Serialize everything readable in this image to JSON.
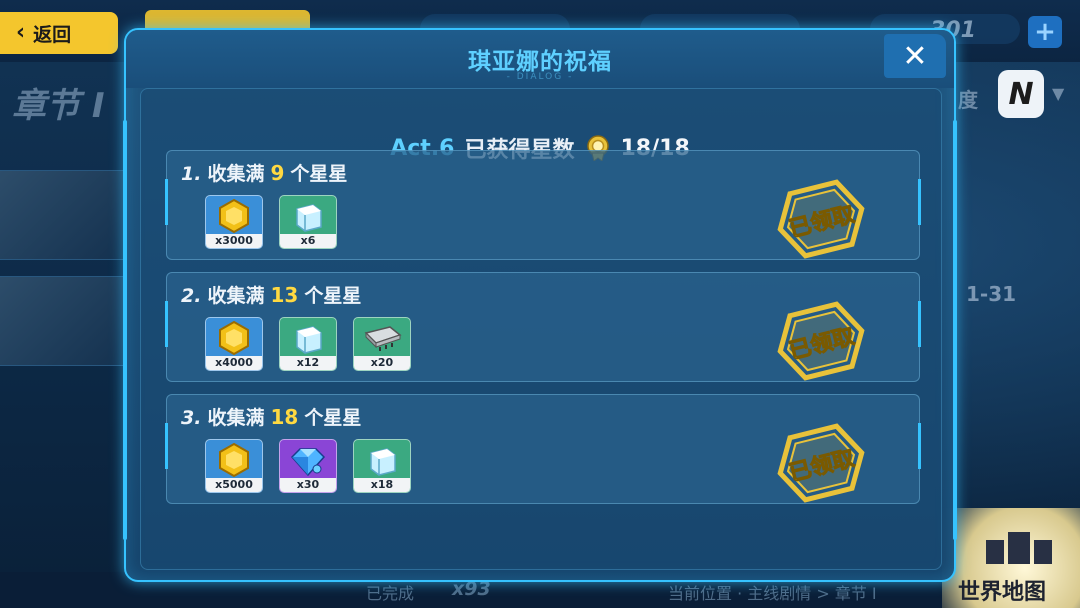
{
  "background": {
    "back_label": "返回",
    "chapter": "章节 I",
    "difficulty_label": "度",
    "difficulty_value": "N",
    "stage_code": "1-31",
    "top_count": "301",
    "footer": {
      "complete_label": "已完成",
      "complete_count": "x93",
      "location": "当前位置 · 主线剧情 > 章节 I"
    },
    "world_map_label": "世界地图"
  },
  "dialog": {
    "title": "琪亚娜的祝福",
    "subtitle": "DIALOG",
    "close_icon": "✕",
    "act": "Act.6",
    "stars_label": "已获得星数",
    "stars_count": "18/18",
    "tasks": [
      {
        "num": "1.",
        "prefix": "收集满",
        "goal": "9",
        "suffix": "个星星",
        "status": "已领取",
        "rewards": [
          {
            "item": "gold-coin",
            "qty": "x3000"
          },
          {
            "item": "ice-cube",
            "qty": "x6"
          }
        ]
      },
      {
        "num": "2.",
        "prefix": "收集满",
        "goal": "13",
        "suffix": "个星星",
        "status": "已领取",
        "rewards": [
          {
            "item": "gold-coin",
            "qty": "x4000"
          },
          {
            "item": "ice-cube",
            "qty": "x12"
          },
          {
            "item": "chip",
            "qty": "x20"
          }
        ]
      },
      {
        "num": "3.",
        "prefix": "收集满",
        "goal": "18",
        "suffix": "个星星",
        "status": "已领取",
        "rewards": [
          {
            "item": "gold-coin",
            "qty": "x5000"
          },
          {
            "item": "crystal",
            "qty": "x30"
          },
          {
            "item": "ice-cube",
            "qty": "x18"
          }
        ]
      }
    ]
  },
  "colors": {
    "accent_blue": "#36c3ff",
    "title_blue": "#5ed0ff",
    "goal_yellow": "#ffd941",
    "stamp_gold": "#e8c23a"
  }
}
